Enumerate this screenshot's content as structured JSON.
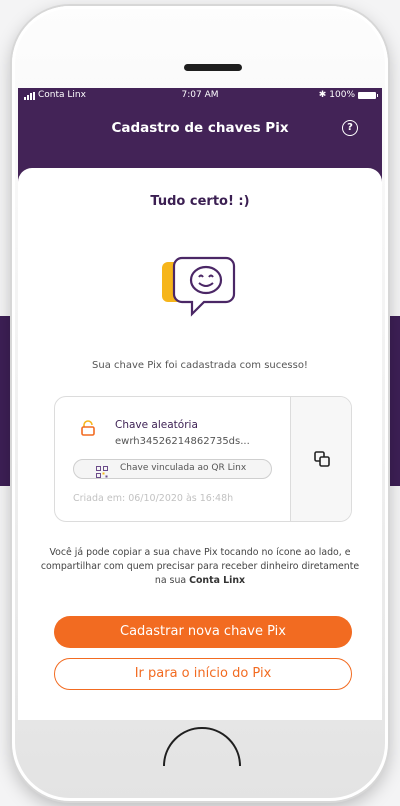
{
  "status_bar": {
    "carrier": "Conta Linx",
    "time": "7:07 AM",
    "battery": "100%"
  },
  "header": {
    "title": "Cadastro de chaves Pix",
    "help_icon": "question-mark-icon"
  },
  "success": {
    "title": "Tudo certo! :)",
    "illustration_icon": "smiley-chat-icon",
    "message": "Sua chave Pix foi cadastrada com sucesso!"
  },
  "key_card": {
    "type": "Chave aleatória",
    "value": "ewrh34526214862735ds...",
    "qr_label": "Chave vinculada ao QR Linx",
    "created": "Criada em:  06/10/2020 às 16:48h",
    "copy_icon": "copy-icon",
    "lock_icon": "lock-icon",
    "qr_icon": "qr-code-icon"
  },
  "info": {
    "text_part1": "Você já pode copiar a sua chave Pix tocando no ícone ao lado, e compartilhar com quem precisar para receber dinheiro diretamente na sua ",
    "text_bold": "Conta Linx"
  },
  "actions": {
    "primary": "Cadastrar nova chave Pix",
    "secondary": "Ir para o início do Pix"
  },
  "colors": {
    "brand_purple": "#432357",
    "accent_orange": "#f26b21",
    "smiley_yellow": "#f6b51b"
  }
}
